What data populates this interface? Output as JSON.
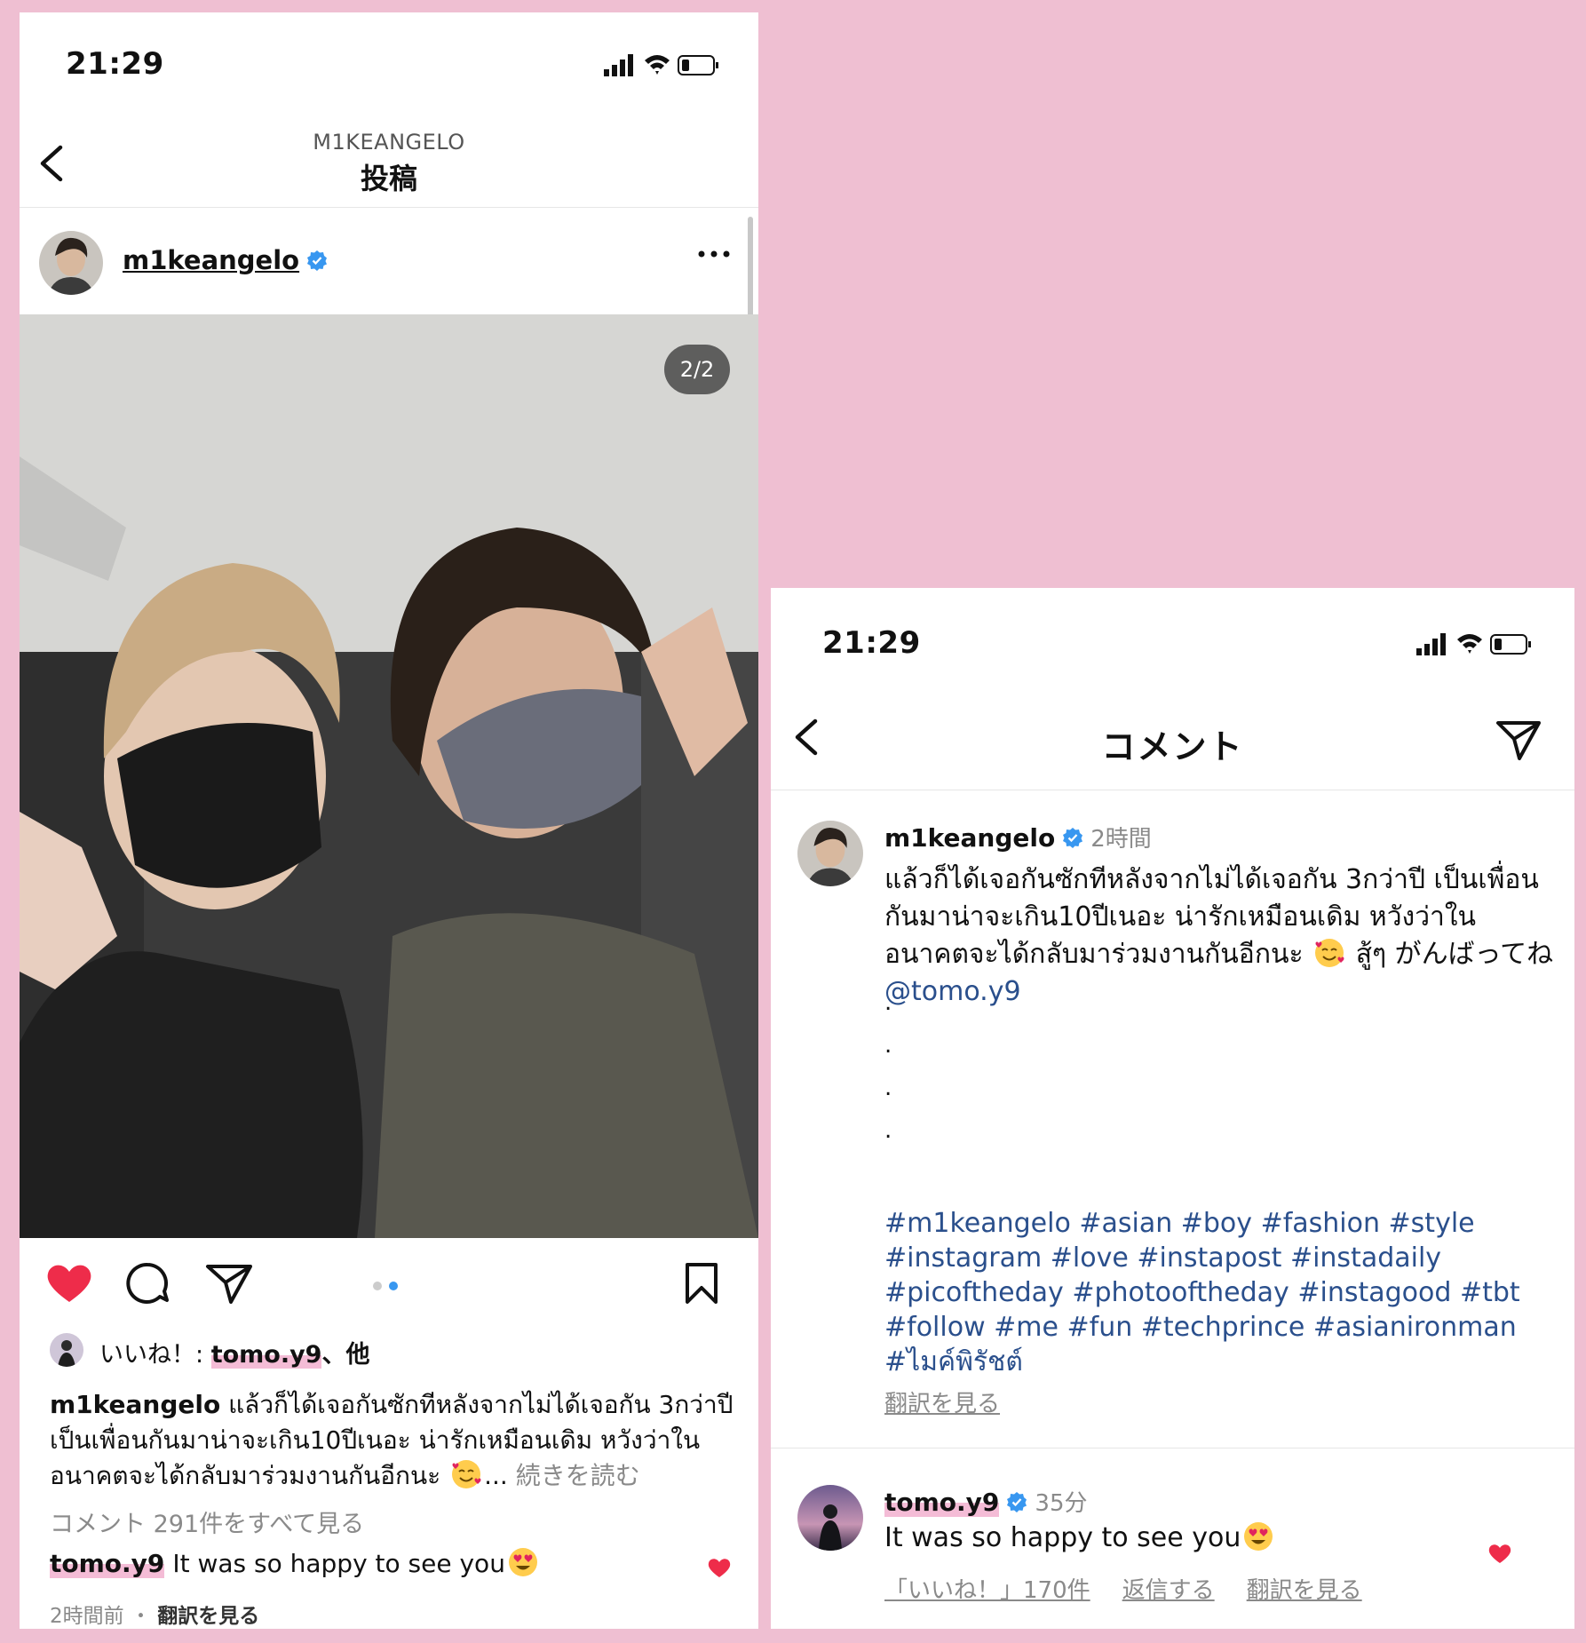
{
  "colors": {
    "background": "#efbfd2",
    "like_red": "#ee2c4a",
    "link_blue": "#2a4f8c",
    "verified_blue": "#3897f0",
    "highlight_pink": "#f4bcd6"
  },
  "post_screen": {
    "status_time": "21:29",
    "header_subtitle": "M1KEANGELO",
    "header_title": "投稿",
    "username": "m1keangelo",
    "photo_counter": "2/2",
    "likes": {
      "prefix": "いいね！: ",
      "user": "tomo.y9",
      "suffix": "、他"
    },
    "caption": {
      "user": "m1keangelo",
      "text": "แล้วก็ได้เจอกันซักทีหลังจากไม่ได้เจอกัน 3กว่าปี เป็นเพื่อนกันมาน่าจะเกิน10ปีเนอะ น่ารักเหมือนเดิม หวังว่าในอนาคตจะได้กลับมาร่วมงานกันอีกนะ",
      "ellipsis": "...",
      "more": "続きを読む"
    },
    "view_all_comments": "コメント 291件をすべて見る",
    "top_comment": {
      "user": "tomo.y9",
      "text": "It was so happy to see you"
    },
    "meta": {
      "time": "2時間前",
      "separator": "・",
      "translate": "翻訳を見る"
    }
  },
  "comments_screen": {
    "status_time": "21:29",
    "title": "コメント",
    "caption": {
      "user": "m1keangelo",
      "time": "2時間",
      "text": "แล้วก็ได้เจอกันซักทีหลังจากไม่ได้เจอกัน 3กว่าปี เป็นเพื่อนกันมาน่าจะเกิน10ปีเนอะ น่ารักเหมือนเดิม หวังว่าในอนาคตจะได้กลับมาร่วมงานกันอีกนะ",
      "text_after_emoji": " สู้ๆ がんばってね ",
      "mention": "@tomo.y9",
      "dots": [
        ".",
        ".",
        ".",
        "."
      ],
      "hashtags": "#m1keangelo #asian #boy #fashion #style #instagram #love #instapost #instadaily #picoftheday #photooftheday #instagood #tbt #follow #me #fun #techprince #asianironman #ไมค์พิรัชต์",
      "translate": "翻訳を見る"
    },
    "reply": {
      "user": "tomo.y9",
      "time": "35分",
      "text": "It was so happy to see you",
      "likes": "「いいね！」170件",
      "reply_label": "返信する",
      "translate": "翻訳を見る"
    }
  }
}
